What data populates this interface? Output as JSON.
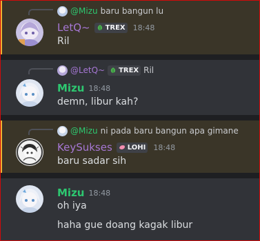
{
  "messages": [
    {
      "reply": {
        "author": "@Mizu",
        "text": "baru bangun lu"
      },
      "author": "LetQ~",
      "tag": "TREX",
      "time": "18:48",
      "lines": [
        "Ril"
      ]
    },
    {
      "reply": {
        "author": "@LetQ~",
        "tag": "TREX",
        "text": "Ril"
      },
      "author": "Mizu",
      "time": "18:48",
      "lines": [
        "demn, libur kah?"
      ]
    },
    {
      "reply": {
        "author": "@Mizu",
        "text": "ni pada baru bangun apa gimane"
      },
      "author": "KeySukses",
      "tag": "LOHI",
      "time": "18:48",
      "lines": [
        "baru sadar sih"
      ]
    },
    {
      "author": "Mizu",
      "time": "18:48",
      "lines": [
        "oh iya",
        "haha gue doang kagak libur"
      ]
    }
  ],
  "colors": {
    "mention_bar": "#f0b232",
    "mention_bg": "#3a3528",
    "green_name": "#2dc770",
    "purple_name": "#a677d4",
    "chat_bg": "#313338"
  },
  "icons": [
    "trex-leaf-icon",
    "lohi-heart-icon"
  ]
}
